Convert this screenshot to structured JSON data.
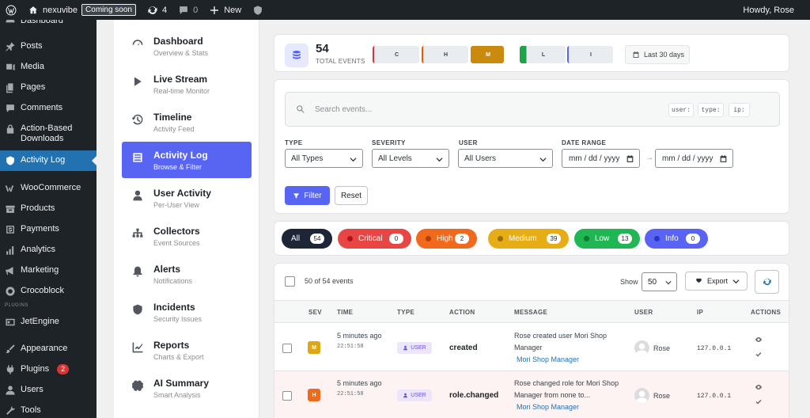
{
  "adminbar": {
    "site_name": "nexuvibe",
    "coming_soon": "Coming soon",
    "updates_count": "4",
    "comments_count": "0",
    "new_label": "New",
    "howdy": "Howdy, Rose"
  },
  "wpmenu": {
    "items": [
      {
        "label": "Dashboard"
      },
      {
        "label": "Posts"
      },
      {
        "label": "Media"
      },
      {
        "label": "Pages"
      },
      {
        "label": "Comments"
      },
      {
        "label": "Action-Based Downloads"
      },
      {
        "label": "Activity Log"
      },
      {
        "label": "WooCommerce"
      },
      {
        "label": "Products"
      },
      {
        "label": "Payments"
      },
      {
        "label": "Analytics"
      },
      {
        "label": "Marketing"
      },
      {
        "label": "Crocoblock"
      },
      {
        "label": "JetEngine"
      },
      {
        "label": "Appearance"
      },
      {
        "label": "Plugins",
        "badge": "2"
      },
      {
        "label": "Users"
      },
      {
        "label": "Tools"
      }
    ],
    "plugins_sep": "PLUGINS"
  },
  "pluginnav": {
    "items": [
      {
        "title": "Dashboard",
        "subtitle": "Overview & Stats"
      },
      {
        "title": "Live Stream",
        "subtitle": "Real-time Monitor"
      },
      {
        "title": "Timeline",
        "subtitle": "Activity Feed"
      },
      {
        "title": "Activity Log",
        "subtitle": "Browse & Filter"
      },
      {
        "title": "User Activity",
        "subtitle": "Per-User View"
      },
      {
        "title": "Collectors",
        "subtitle": "Event Sources"
      },
      {
        "title": "Alerts",
        "subtitle": "Notifications"
      },
      {
        "title": "Incidents",
        "subtitle": "Security Issues"
      },
      {
        "title": "Reports",
        "subtitle": "Charts & Export"
      },
      {
        "title": "AI Summary",
        "subtitle": "Smart Analysis"
      }
    ]
  },
  "stats": {
    "total": "54",
    "total_label": "TOTAL EVENTS",
    "severity_boxes": [
      {
        "label": "C",
        "fill": 0,
        "color": "#d63638"
      },
      {
        "label": "H",
        "fill": 0,
        "color": "#e65c00"
      },
      {
        "label": "M",
        "fill": 1,
        "color": "#c98a0e"
      },
      {
        "label": "L",
        "fill": 0.12,
        "color": "#1fa34a"
      },
      {
        "label": "I",
        "fill": 0,
        "color": "#5865f2"
      }
    ],
    "range_label": "Last 30 days"
  },
  "filters": {
    "search_placeholder": "Search events...",
    "chips": [
      "user:",
      "type:",
      "ip:"
    ],
    "type_label": "TYPE",
    "type_value": "All Types",
    "severity_label": "SEVERITY",
    "severity_value": "All Levels",
    "user_label": "USER",
    "user_value": "All Users",
    "date_label": "DATE RANGE",
    "date_from": "mm / dd / yyyy",
    "date_arrow": "→",
    "date_to": "mm / dd / yyyy",
    "filter_btn": "Filter",
    "reset_btn": "Reset"
  },
  "pills": [
    {
      "label": "All",
      "count": "54",
      "bg": "#1d2536",
      "fg": "#ffffff"
    },
    {
      "label": "Critical",
      "count": "0",
      "bg": "#e84545",
      "fg": "#ffffff",
      "dot": "#b3121b"
    },
    {
      "label": "High",
      "count": "2",
      "bg": "#f06a1d",
      "fg": "#ffffff",
      "dot": "#b63d00"
    },
    {
      "label": "Medium",
      "count": "39",
      "bg": "#e7ad16",
      "fg": "#ffffff",
      "dot": "#9c6d00"
    },
    {
      "label": "Low",
      "count": "13",
      "bg": "#20b653",
      "fg": "#ffffff",
      "dot": "#0d7b30"
    },
    {
      "label": "Info",
      "count": "0",
      "bg": "#5964f4",
      "fg": "#ffffff",
      "dot": "#2c36c4"
    }
  ],
  "table": {
    "count_text": "50 of 54 events",
    "show_label": "Show",
    "show_value": "50",
    "export_label": "Export",
    "headers": [
      "SEV",
      "TIME",
      "TYPE",
      "ACTION",
      "MESSAGE",
      "USER",
      "IP",
      "ACTIONS"
    ],
    "rows": [
      {
        "sev": "M",
        "sev_color": "#e0a610",
        "time_rel": "5 minutes ago",
        "time_abs": "22:51:58",
        "type": "USER",
        "action": "created",
        "message": "Rose created user Mori Shop Manager",
        "link": "Mori Shop Manager",
        "user": "Rose",
        "ip": "127.0.0.1",
        "bg": "#ffffff"
      },
      {
        "sev": "H",
        "sev_color": "#f06a1d",
        "time_rel": "5 minutes ago",
        "time_abs": "22:51:58",
        "type": "USER",
        "action": "role.changed",
        "message": "Rose changed role for Mori Shop Manager from none to...",
        "link": "Mori Shop Manager",
        "user": "Rose",
        "ip": "127.0.0.1",
        "bg": "#fdf3f3"
      }
    ]
  }
}
